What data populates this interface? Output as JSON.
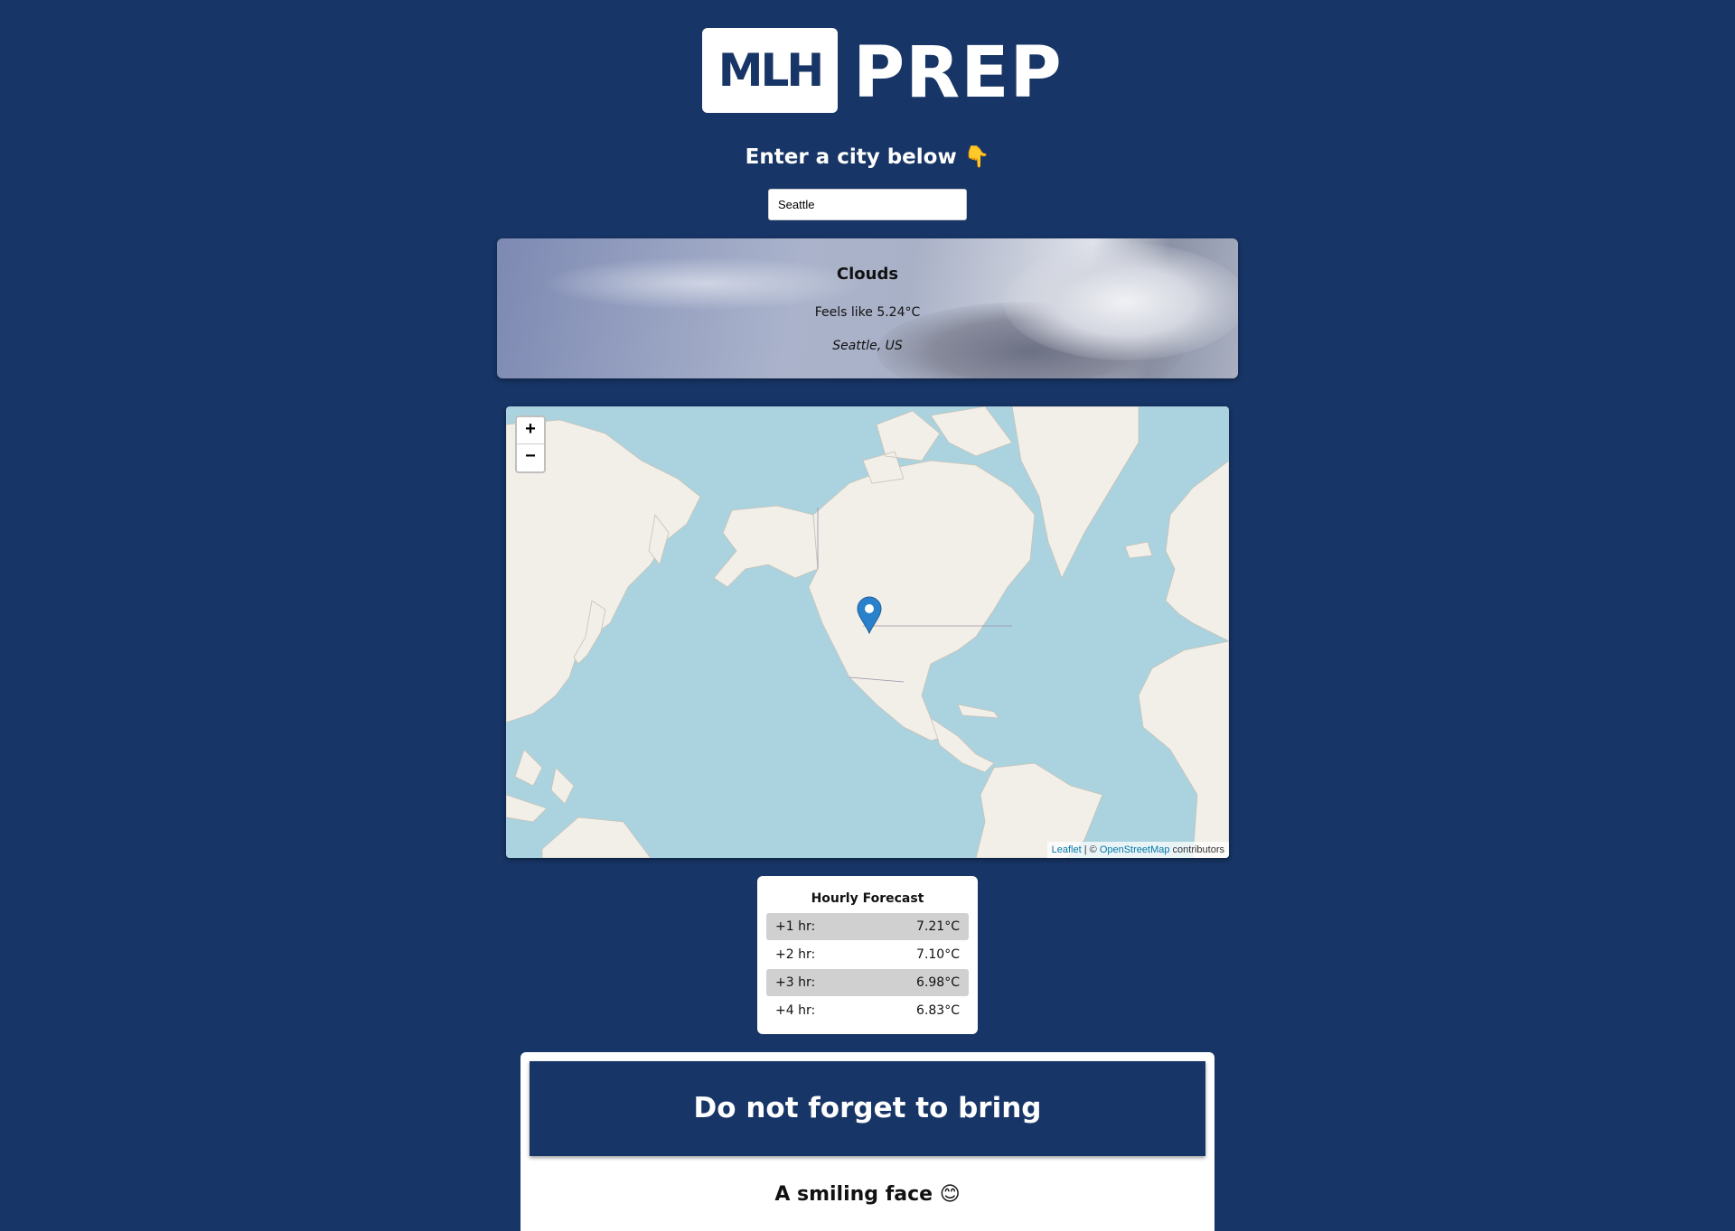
{
  "logo": {
    "mark": "MLH",
    "word": "PREP"
  },
  "prompt": {
    "heading": "Enter a city below 👇"
  },
  "search": {
    "value": "Seattle"
  },
  "weather": {
    "main": "Clouds",
    "feels_like": "Feels like 5.24°C",
    "location": "Seattle, US"
  },
  "map": {
    "zoom_in": "+",
    "zoom_out": "−",
    "attribution": {
      "leaflet": "Leaflet",
      "sep": " | © ",
      "osm": "OpenStreetMap",
      "contributors": " contributors"
    },
    "marker_icon": "map-pin-icon"
  },
  "forecast": {
    "title": "Hourly Forecast",
    "rows": [
      {
        "label": "+1 hr:",
        "value": "7.21°C"
      },
      {
        "label": "+2 hr:",
        "value": "7.10°C"
      },
      {
        "label": "+3 hr:",
        "value": "6.98°C"
      },
      {
        "label": "+4 hr:",
        "value": "6.83°C"
      }
    ]
  },
  "bring": {
    "title": "Do not forget to bring",
    "item": "A smiling face 😊"
  },
  "colors": {
    "background": "#173566",
    "water": "#aad3df",
    "land": "#f2efe9",
    "marker": "#2a81cb"
  }
}
